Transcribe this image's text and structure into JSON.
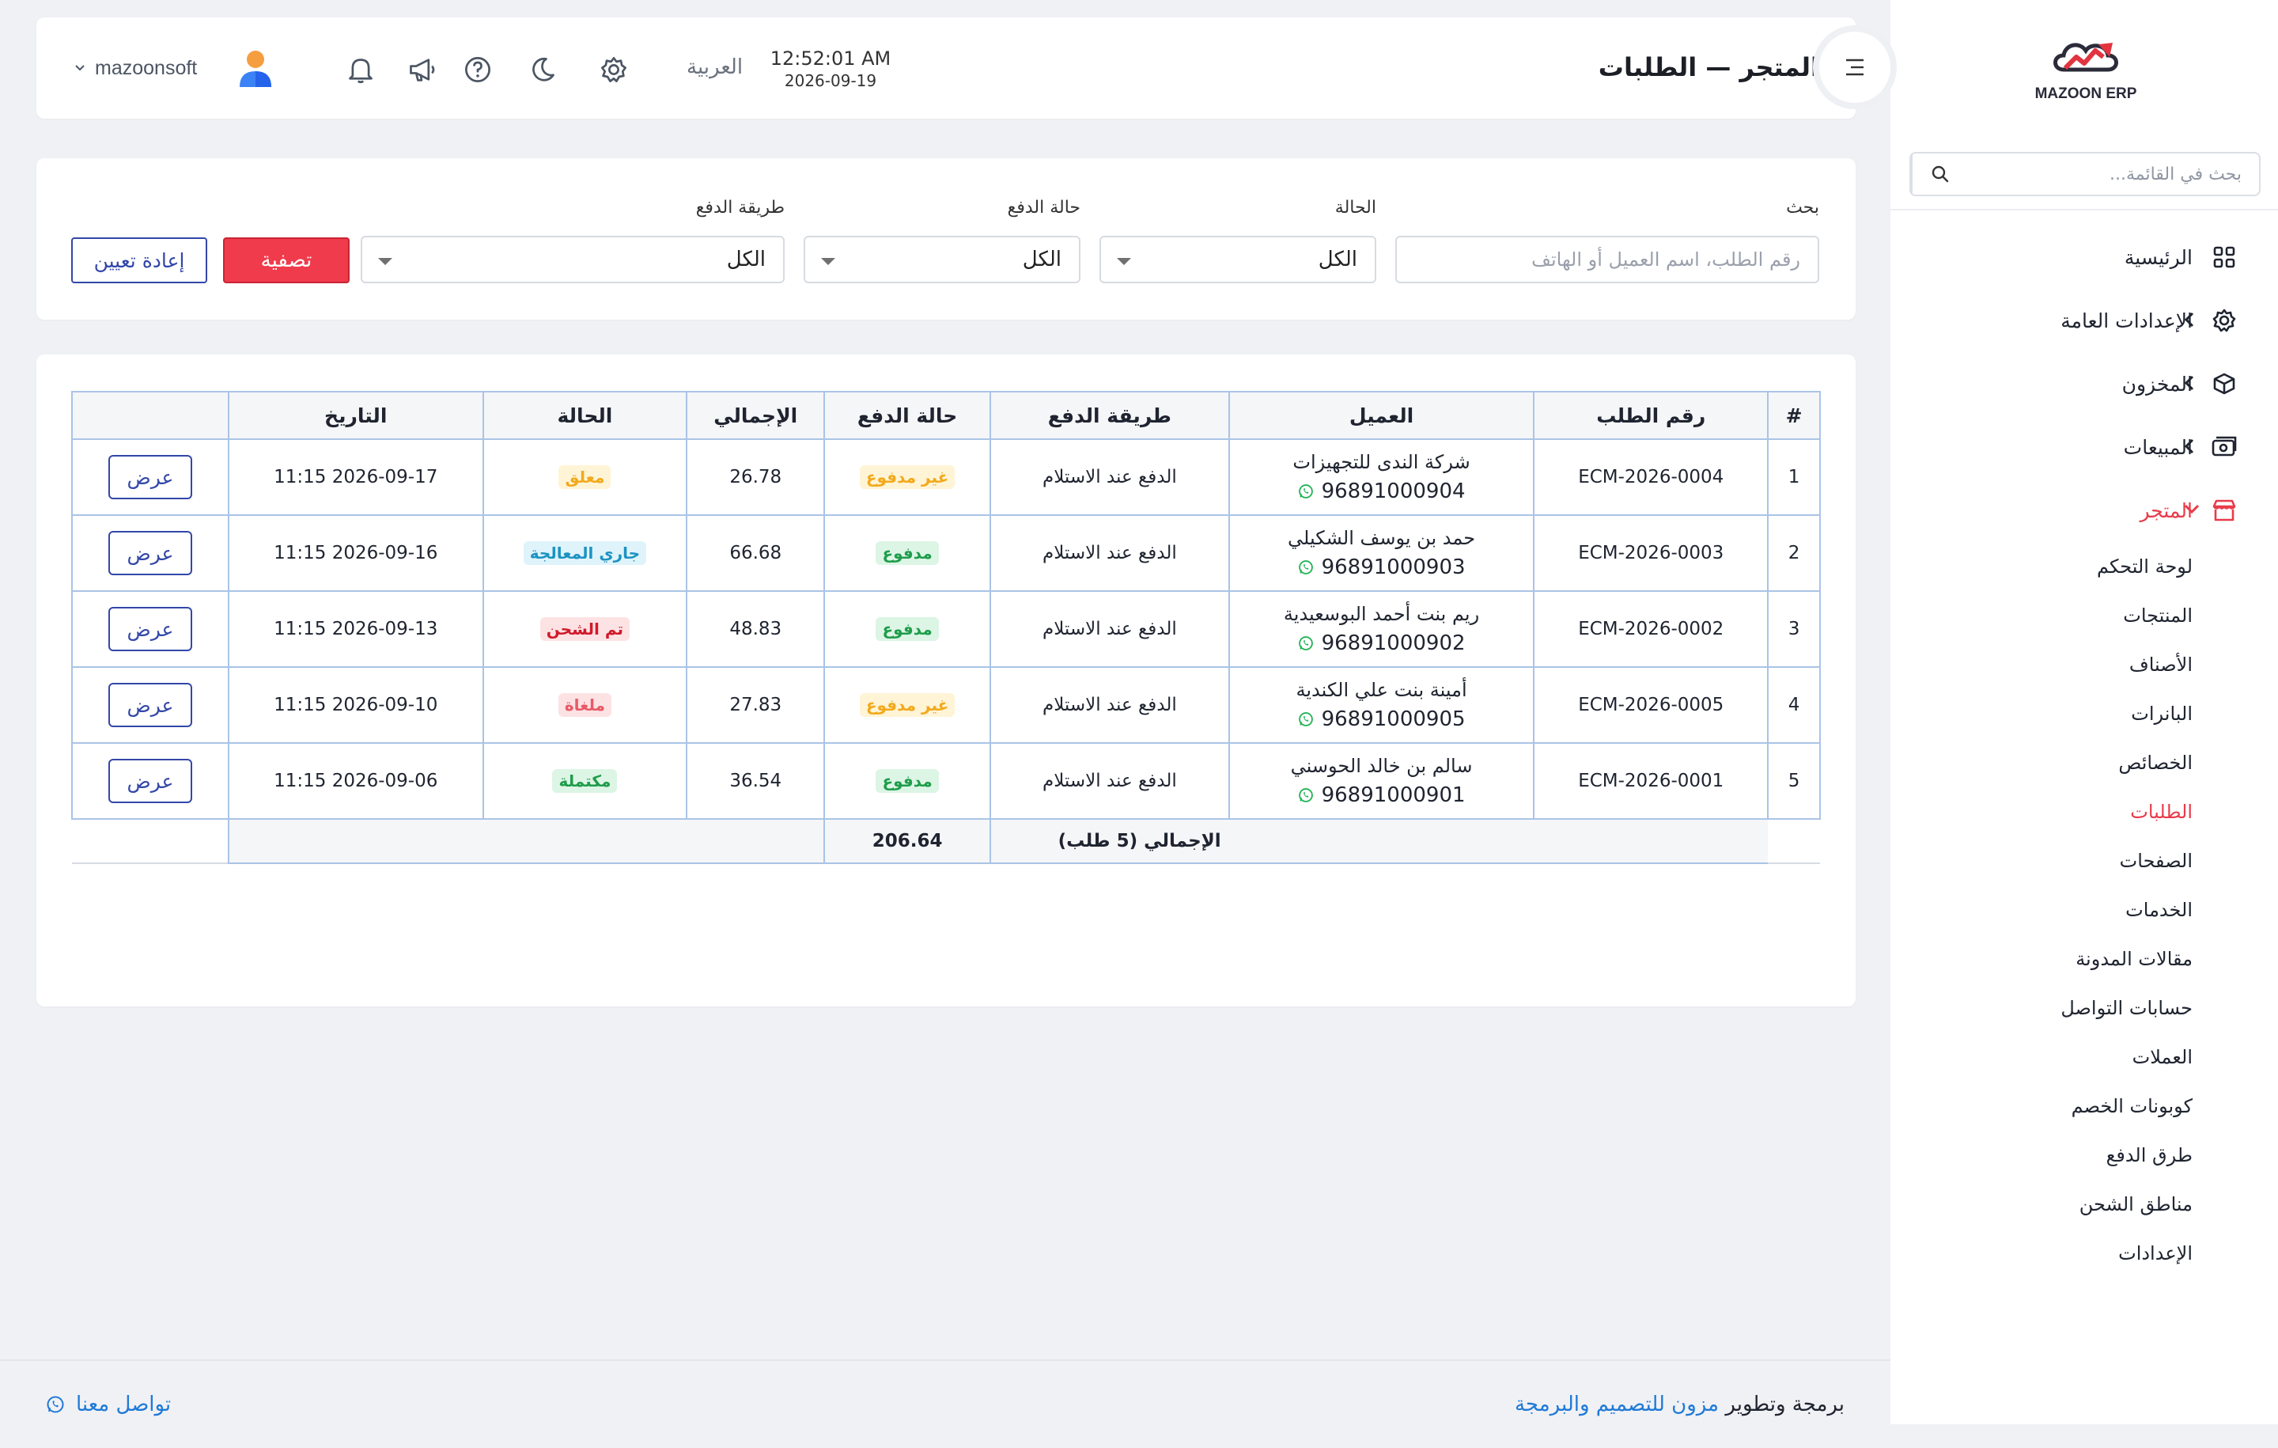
{
  "app": {
    "logo_text": "MAZOON ERP"
  },
  "sidebar": {
    "search_placeholder": "بحث في القائمة...",
    "items": [
      {
        "label": "الرئيسية",
        "icon": "grid-icon"
      },
      {
        "label": "الإعدادات العامة",
        "icon": "gear-icon"
      },
      {
        "label": "المخزون",
        "icon": "box-icon"
      },
      {
        "label": "المبيعات",
        "icon": "cash-icon"
      },
      {
        "label": "المتجر",
        "icon": "store-icon"
      }
    ],
    "store_sub": [
      "لوحة التحكم",
      "المنتجات",
      "الأصناف",
      "البانرات",
      "الخصائص",
      "الطلبات",
      "الصفحات",
      "الخدمات",
      "مقالات المدونة",
      "حسابات التواصل",
      "العملات",
      "كوبونات الخصم",
      "طرق الدفع",
      "مناطق الشحن",
      "الإعدادات"
    ]
  },
  "header": {
    "title": "المتجر — الطلبات",
    "time": "12:52:01 AM",
    "date": "2026-09-19",
    "language": "العربية",
    "username": "mazoonsoft"
  },
  "filters": {
    "search_label": "بحث",
    "search_placeholder": "رقم الطلب، اسم العميل أو الهاتف",
    "status_label": "الحالة",
    "status_value": "الكل",
    "payment_status_label": "حالة الدفع",
    "payment_status_value": "الكل",
    "payment_method_label": "طريقة الدفع",
    "payment_method_value": "الكل",
    "filter_button": "تصفية",
    "reset_button": "إعادة تعيين"
  },
  "table": {
    "headers": [
      "#",
      "رقم الطلب",
      "العميل",
      "طريقة الدفع",
      "حالة الدفع",
      "الإجمالي",
      "الحالة",
      "التاريخ",
      ""
    ],
    "rows": [
      {
        "idx": "1",
        "order": "ECM-2026-0004",
        "customer": "شركة الندى للتجهيزات",
        "phone": "96891000904",
        "method": "الدفع عند الاستلام",
        "pay_status": "غير مدفوع",
        "total": "26.78",
        "status": "معلق",
        "date": "2026-09-17 11:15",
        "view": "عرض"
      },
      {
        "idx": "2",
        "order": "ECM-2026-0003",
        "customer": "حمد بن يوسف الشكيلي",
        "phone": "96891000903",
        "method": "الدفع عند الاستلام",
        "pay_status": "مدفوع",
        "total": "66.68",
        "status": "جاري المعالجة",
        "date": "2026-09-16 11:15",
        "view": "عرض"
      },
      {
        "idx": "3",
        "order": "ECM-2026-0002",
        "customer": "ريم بنت أحمد البوسعيدية",
        "phone": "96891000902",
        "method": "الدفع عند الاستلام",
        "pay_status": "مدفوع",
        "total": "48.83",
        "status": "تم الشحن",
        "date": "2026-09-13 11:15",
        "view": "عرض"
      },
      {
        "idx": "4",
        "order": "ECM-2026-0005",
        "customer": "أمينة بنت علي الكندية",
        "phone": "96891000905",
        "method": "الدفع عند الاستلام",
        "pay_status": "غير مدفوع",
        "total": "27.83",
        "status": "ملغاة",
        "date": "2026-09-10 11:15",
        "view": "عرض"
      },
      {
        "idx": "5",
        "order": "ECM-2026-0001",
        "customer": "سالم بن خالد الحوسني",
        "phone": "96891000901",
        "method": "الدفع عند الاستلام",
        "pay_status": "مدفوع",
        "total": "36.54",
        "status": "مكتملة",
        "date": "2026-09-06 11:15",
        "view": "عرض"
      }
    ],
    "footer_label": "الإجمالي (5 طلب)",
    "footer_total": "206.64"
  },
  "badge_colors": {
    "غير مدفوع": {
      "bg": "#fff4d6",
      "fg": "#f2a91c"
    },
    "مدفوع": {
      "bg": "#dcf5e5",
      "fg": "#1f9d4b"
    },
    "معلق": {
      "bg": "#fff4d6",
      "fg": "#f2a91c"
    },
    "جاري المعالجة": {
      "bg": "#dff3fb",
      "fg": "#1c93c2"
    },
    "تم الشحن": {
      "bg": "#fde2e4",
      "fg": "#d11a2a"
    },
    "ملغاة": {
      "bg": "#fde2e4",
      "fg": "#e85a67"
    },
    "مكتملة": {
      "bg": "#dcf5e5",
      "fg": "#1f9d4b"
    }
  },
  "footer": {
    "credit_prefix": "برمجة وتطوير",
    "credit_link": "مزون للتصميم والبرمجة",
    "contact": "تواصل معنا"
  }
}
